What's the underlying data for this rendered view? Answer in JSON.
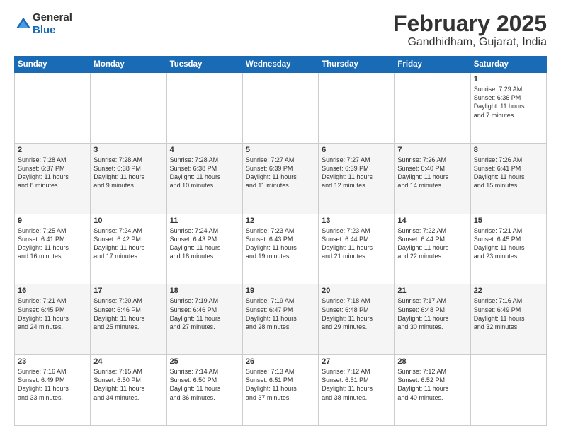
{
  "logo": {
    "general": "General",
    "blue": "Blue"
  },
  "title": "February 2025",
  "subtitle": "Gandhidham, Gujarat, India",
  "days_of_week": [
    "Sunday",
    "Monday",
    "Tuesday",
    "Wednesday",
    "Thursday",
    "Friday",
    "Saturday"
  ],
  "weeks": [
    [
      {
        "day": "",
        "info": ""
      },
      {
        "day": "",
        "info": ""
      },
      {
        "day": "",
        "info": ""
      },
      {
        "day": "",
        "info": ""
      },
      {
        "day": "",
        "info": ""
      },
      {
        "day": "",
        "info": ""
      },
      {
        "day": "1",
        "info": "Sunrise: 7:29 AM\nSunset: 6:36 PM\nDaylight: 11 hours\nand 7 minutes."
      }
    ],
    [
      {
        "day": "2",
        "info": "Sunrise: 7:28 AM\nSunset: 6:37 PM\nDaylight: 11 hours\nand 8 minutes."
      },
      {
        "day": "3",
        "info": "Sunrise: 7:28 AM\nSunset: 6:38 PM\nDaylight: 11 hours\nand 9 minutes."
      },
      {
        "day": "4",
        "info": "Sunrise: 7:28 AM\nSunset: 6:38 PM\nDaylight: 11 hours\nand 10 minutes."
      },
      {
        "day": "5",
        "info": "Sunrise: 7:27 AM\nSunset: 6:39 PM\nDaylight: 11 hours\nand 11 minutes."
      },
      {
        "day": "6",
        "info": "Sunrise: 7:27 AM\nSunset: 6:39 PM\nDaylight: 11 hours\nand 12 minutes."
      },
      {
        "day": "7",
        "info": "Sunrise: 7:26 AM\nSunset: 6:40 PM\nDaylight: 11 hours\nand 14 minutes."
      },
      {
        "day": "8",
        "info": "Sunrise: 7:26 AM\nSunset: 6:41 PM\nDaylight: 11 hours\nand 15 minutes."
      }
    ],
    [
      {
        "day": "9",
        "info": "Sunrise: 7:25 AM\nSunset: 6:41 PM\nDaylight: 11 hours\nand 16 minutes."
      },
      {
        "day": "10",
        "info": "Sunrise: 7:24 AM\nSunset: 6:42 PM\nDaylight: 11 hours\nand 17 minutes."
      },
      {
        "day": "11",
        "info": "Sunrise: 7:24 AM\nSunset: 6:43 PM\nDaylight: 11 hours\nand 18 minutes."
      },
      {
        "day": "12",
        "info": "Sunrise: 7:23 AM\nSunset: 6:43 PM\nDaylight: 11 hours\nand 19 minutes."
      },
      {
        "day": "13",
        "info": "Sunrise: 7:23 AM\nSunset: 6:44 PM\nDaylight: 11 hours\nand 21 minutes."
      },
      {
        "day": "14",
        "info": "Sunrise: 7:22 AM\nSunset: 6:44 PM\nDaylight: 11 hours\nand 22 minutes."
      },
      {
        "day": "15",
        "info": "Sunrise: 7:21 AM\nSunset: 6:45 PM\nDaylight: 11 hours\nand 23 minutes."
      }
    ],
    [
      {
        "day": "16",
        "info": "Sunrise: 7:21 AM\nSunset: 6:45 PM\nDaylight: 11 hours\nand 24 minutes."
      },
      {
        "day": "17",
        "info": "Sunrise: 7:20 AM\nSunset: 6:46 PM\nDaylight: 11 hours\nand 25 minutes."
      },
      {
        "day": "18",
        "info": "Sunrise: 7:19 AM\nSunset: 6:46 PM\nDaylight: 11 hours\nand 27 minutes."
      },
      {
        "day": "19",
        "info": "Sunrise: 7:19 AM\nSunset: 6:47 PM\nDaylight: 11 hours\nand 28 minutes."
      },
      {
        "day": "20",
        "info": "Sunrise: 7:18 AM\nSunset: 6:48 PM\nDaylight: 11 hours\nand 29 minutes."
      },
      {
        "day": "21",
        "info": "Sunrise: 7:17 AM\nSunset: 6:48 PM\nDaylight: 11 hours\nand 30 minutes."
      },
      {
        "day": "22",
        "info": "Sunrise: 7:16 AM\nSunset: 6:49 PM\nDaylight: 11 hours\nand 32 minutes."
      }
    ],
    [
      {
        "day": "23",
        "info": "Sunrise: 7:16 AM\nSunset: 6:49 PM\nDaylight: 11 hours\nand 33 minutes."
      },
      {
        "day": "24",
        "info": "Sunrise: 7:15 AM\nSunset: 6:50 PM\nDaylight: 11 hours\nand 34 minutes."
      },
      {
        "day": "25",
        "info": "Sunrise: 7:14 AM\nSunset: 6:50 PM\nDaylight: 11 hours\nand 36 minutes."
      },
      {
        "day": "26",
        "info": "Sunrise: 7:13 AM\nSunset: 6:51 PM\nDaylight: 11 hours\nand 37 minutes."
      },
      {
        "day": "27",
        "info": "Sunrise: 7:12 AM\nSunset: 6:51 PM\nDaylight: 11 hours\nand 38 minutes."
      },
      {
        "day": "28",
        "info": "Sunrise: 7:12 AM\nSunset: 6:52 PM\nDaylight: 11 hours\nand 40 minutes."
      },
      {
        "day": "",
        "info": ""
      }
    ]
  ]
}
